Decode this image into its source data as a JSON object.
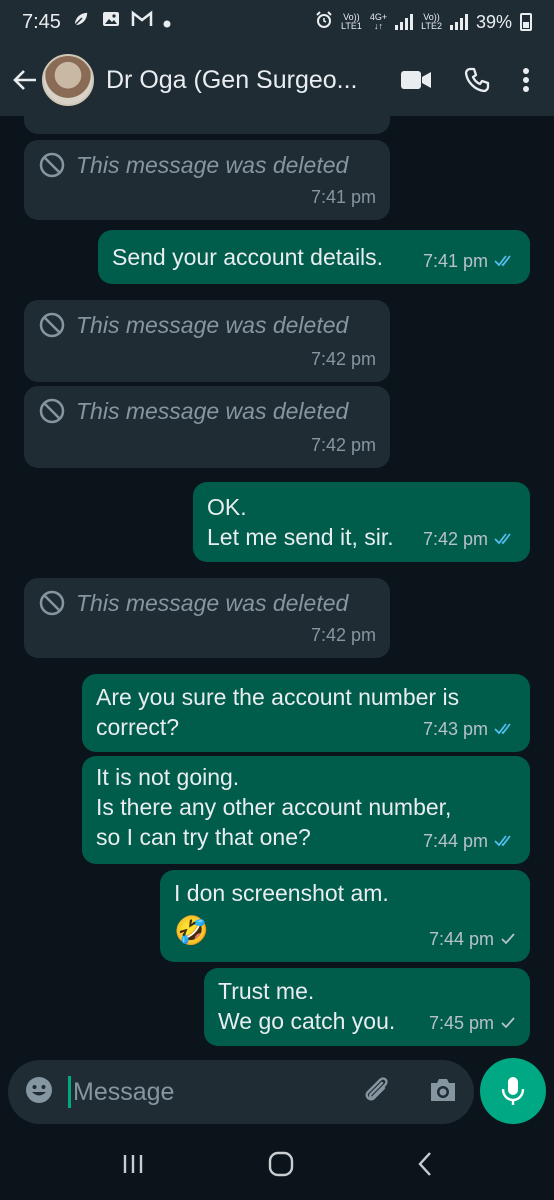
{
  "status_bar": {
    "time": "7:45",
    "lte1_top": "Vo))",
    "lte1_bottom": "LTE1",
    "net_type": "4G+",
    "lte2_top": "Vo))",
    "lte2_bottom": "LTE2",
    "battery": "39%"
  },
  "header": {
    "contact_name": "Dr Oga (Gen Surgeo..."
  },
  "messages": [
    {
      "type": "deleted",
      "text": "This message was deleted",
      "time": "7:41 pm"
    },
    {
      "type": "outgoing",
      "text": "Send your account details.",
      "time": "7:41 pm",
      "ticks": "read"
    },
    {
      "type": "deleted",
      "text": "This message was deleted",
      "time": "7:42 pm"
    },
    {
      "type": "deleted",
      "text": "This message was deleted",
      "time": "7:42 pm"
    },
    {
      "type": "outgoing",
      "text": "OK.\nLet me send it, sir.",
      "time": "7:42 pm",
      "ticks": "read"
    },
    {
      "type": "deleted",
      "text": "This message was deleted",
      "time": "7:42 pm"
    },
    {
      "type": "outgoing",
      "text": "Are you sure the account number is\ncorrect?",
      "time": "7:43 pm",
      "ticks": "read"
    },
    {
      "type": "outgoing",
      "text": "It is not going.\nIs there any other account number,\nso I can try that one?",
      "time": "7:44 pm",
      "ticks": "read"
    },
    {
      "type": "outgoing",
      "text": "I don screenshot am.",
      "emoji": "🤣",
      "time": "7:44 pm",
      "ticks": "sent"
    },
    {
      "type": "outgoing",
      "text": "Trust me.\nWe go catch you.",
      "time": "7:45 pm",
      "ticks": "sent"
    }
  ],
  "input": {
    "placeholder": "Message"
  },
  "colors": {
    "chat_bg": "#0b141a",
    "incoming_bubble": "#202c33",
    "outgoing_bubble": "#005c4b",
    "accent": "#00a884",
    "read_tick": "#53bdeb"
  }
}
